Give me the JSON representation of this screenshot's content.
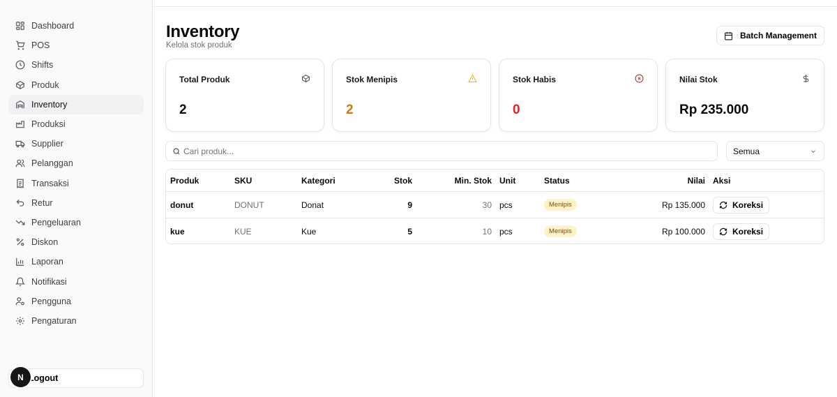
{
  "sidebar": {
    "items": [
      {
        "label": "Dashboard",
        "icon": "dashboard-icon"
      },
      {
        "label": "POS",
        "icon": "cart-icon"
      },
      {
        "label": "Shifts",
        "icon": "clock-icon"
      },
      {
        "label": "Produk",
        "icon": "package-icon"
      },
      {
        "label": "Inventory",
        "icon": "warehouse-icon",
        "active": true
      },
      {
        "label": "Produksi",
        "icon": "factory-icon"
      },
      {
        "label": "Supplier",
        "icon": "truck-icon"
      },
      {
        "label": "Pelanggan",
        "icon": "users-icon"
      },
      {
        "label": "Transaksi",
        "icon": "receipt-icon"
      },
      {
        "label": "Retur",
        "icon": "undo-icon"
      },
      {
        "label": "Pengeluaran",
        "icon": "trending-down-icon"
      },
      {
        "label": "Diskon",
        "icon": "percent-icon"
      },
      {
        "label": "Laporan",
        "icon": "bar-chart-icon"
      },
      {
        "label": "Notifikasi",
        "icon": "bell-icon"
      },
      {
        "label": "Pengguna",
        "icon": "user-cog-icon"
      },
      {
        "label": "Pengaturan",
        "icon": "gear-icon"
      }
    ],
    "logout_label": "Logout",
    "badge_letter": "N"
  },
  "header": {
    "title": "Inventory",
    "subtitle": "Kelola stok produk",
    "batch_button": "Batch Management"
  },
  "stats": [
    {
      "label": "Total Produk",
      "value": "2",
      "icon": "box-icon",
      "color": "#0a0a0a"
    },
    {
      "label": "Stok Menipis",
      "value": "2",
      "icon": "warning-icon",
      "color": "#d97706"
    },
    {
      "label": "Stok Habis",
      "value": "0",
      "icon": "x-circle-icon",
      "color": "#dc2626"
    },
    {
      "label": "Nilai Stok",
      "value": "Rp 235.000",
      "icon": "dollar-icon",
      "color": "#0a0a0a"
    }
  ],
  "search": {
    "placeholder": "Cari produk..."
  },
  "filter": {
    "selected": "Semua"
  },
  "table": {
    "headers": {
      "produk": "Produk",
      "sku": "SKU",
      "kategori": "Kategori",
      "stok": "Stok",
      "min_stok": "Min. Stok",
      "unit": "Unit",
      "status": "Status",
      "nilai": "Nilai",
      "aksi": "Aksi"
    },
    "rows": [
      {
        "produk": "donut",
        "sku": "DONUT",
        "kategori": "Donat",
        "stok": "9",
        "min_stok": "30",
        "unit": "pcs",
        "status": "Menipis",
        "nilai": "Rp 135.000",
        "aksi": "Koreksi"
      },
      {
        "produk": "kue",
        "sku": "KUE",
        "kategori": "Kue",
        "stok": "5",
        "min_stok": "10",
        "unit": "pcs",
        "status": "Menipis",
        "nilai": "Rp 100.000",
        "aksi": "Koreksi"
      }
    ]
  },
  "colors": {
    "accent_warning": "#d97706",
    "danger": "#dc2626",
    "badge_bg": "#fef3c7"
  }
}
